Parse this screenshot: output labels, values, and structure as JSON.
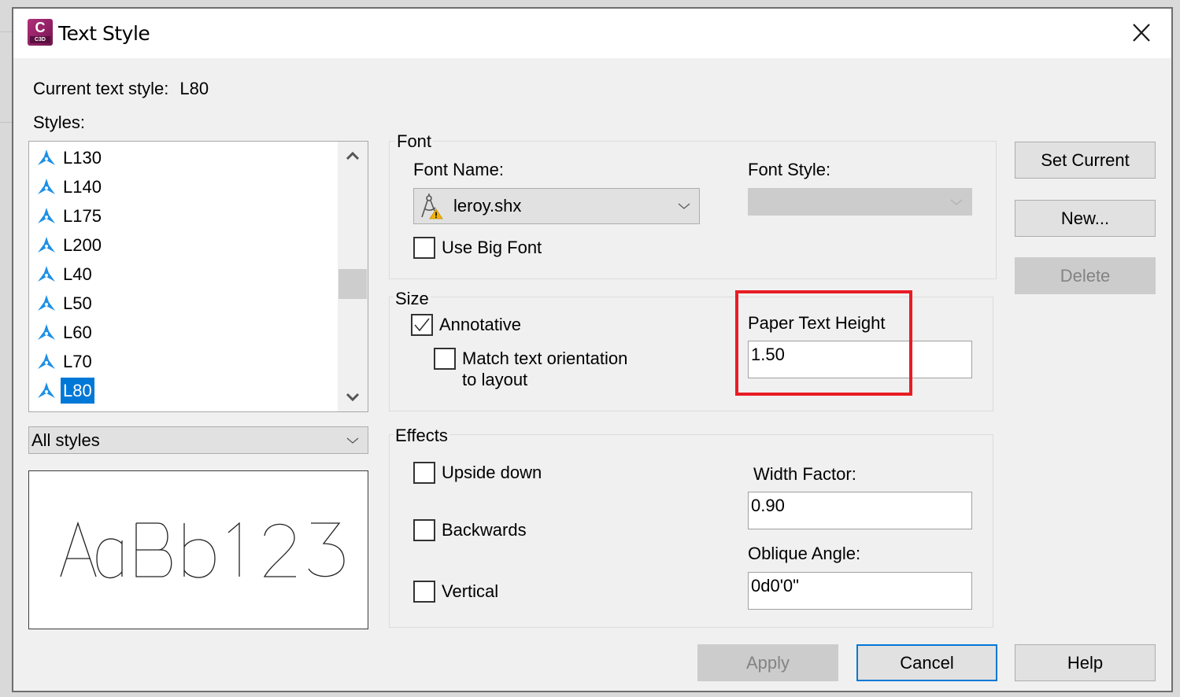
{
  "window": {
    "title": "Text Style",
    "app_icon_letter": "C",
    "app_icon_sub": "C3D"
  },
  "current_style": {
    "label": "Current text style:",
    "value": "L80"
  },
  "styles": {
    "label": "Styles:",
    "items": [
      {
        "name": "L130",
        "selected": false
      },
      {
        "name": "L140",
        "selected": false
      },
      {
        "name": "L175",
        "selected": false
      },
      {
        "name": "L200",
        "selected": false
      },
      {
        "name": "L40",
        "selected": false
      },
      {
        "name": "L50",
        "selected": false
      },
      {
        "name": "L60",
        "selected": false
      },
      {
        "name": "L70",
        "selected": false
      },
      {
        "name": "L80",
        "selected": true
      }
    ],
    "filter_selected": "All styles",
    "preview_text": "AaBb123"
  },
  "font": {
    "group_title": "Font",
    "font_name_label": "Font Name:",
    "font_name_value": "leroy.shx",
    "font_style_label": "Font Style:",
    "font_style_value": "",
    "use_big_font_label": "Use Big Font",
    "use_big_font_checked": false
  },
  "size": {
    "group_title": "Size",
    "annotative_label": "Annotative",
    "annotative_checked": true,
    "match_orientation_label_line1": "Match text orientation",
    "match_orientation_label_line2": "to layout",
    "match_orientation_checked": false,
    "paper_text_height_label": "Paper Text Height",
    "paper_text_height_value": "1.50"
  },
  "effects": {
    "group_title": "Effects",
    "upside_down_label": "Upside down",
    "upside_down_checked": false,
    "backwards_label": "Backwards",
    "backwards_checked": false,
    "vertical_label": "Vertical",
    "vertical_checked": false,
    "width_factor_label": "Width Factor:",
    "width_factor_value": "0.90",
    "oblique_angle_label": "Oblique Angle:",
    "oblique_angle_value": "0d0'0\""
  },
  "buttons": {
    "set_current": "Set Current",
    "new": "New...",
    "delete": "Delete",
    "apply": "Apply",
    "cancel": "Cancel",
    "help": "Help"
  },
  "colors": {
    "selection": "#0078d7",
    "highlight_box": "#e81c24",
    "style_icon": "#1e90e6",
    "app_icon": "#a02a6e"
  }
}
